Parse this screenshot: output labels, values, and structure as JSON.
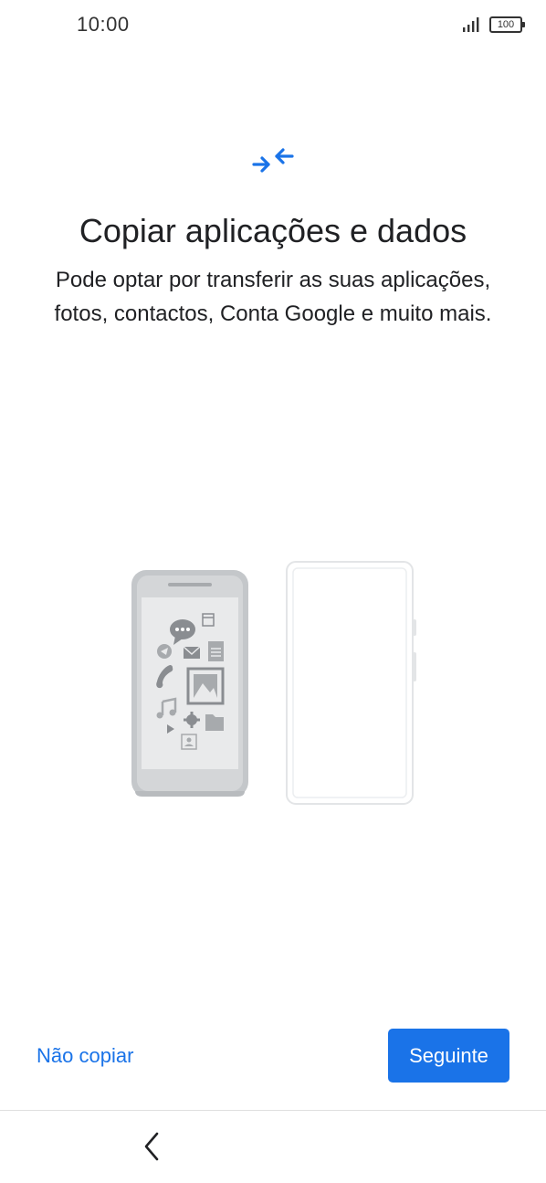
{
  "status_bar": {
    "time": "10:00",
    "battery": "100"
  },
  "header": {
    "icon": "transfer-arrows-icon",
    "title": "Copiar aplicações e dados",
    "description": "Pode optar por transferir as suas aplicações, fotos, contactos, Conta Google e muito mais."
  },
  "illustration": {
    "old_phone_icons": [
      "chat-icon",
      "calendar-icon",
      "send-icon",
      "mail-icon",
      "document-icon",
      "phone-icon",
      "image-icon",
      "music-icon",
      "settings-icon",
      "play-icon",
      "folder-icon",
      "contact-icon"
    ],
    "new_phone": "blank-phone"
  },
  "actions": {
    "skip_label": "Não copiar",
    "next_label": "Seguinte"
  },
  "nav": {
    "back_icon": "back-chevron-icon"
  },
  "colors": {
    "accent": "#1a73e8",
    "title_text": "#202124",
    "phone_gray": "#c4c7ca",
    "phone_screen": "#e9eaeb",
    "icon_gray": "#8a8d91",
    "new_phone_border": "#e3e5e7"
  }
}
